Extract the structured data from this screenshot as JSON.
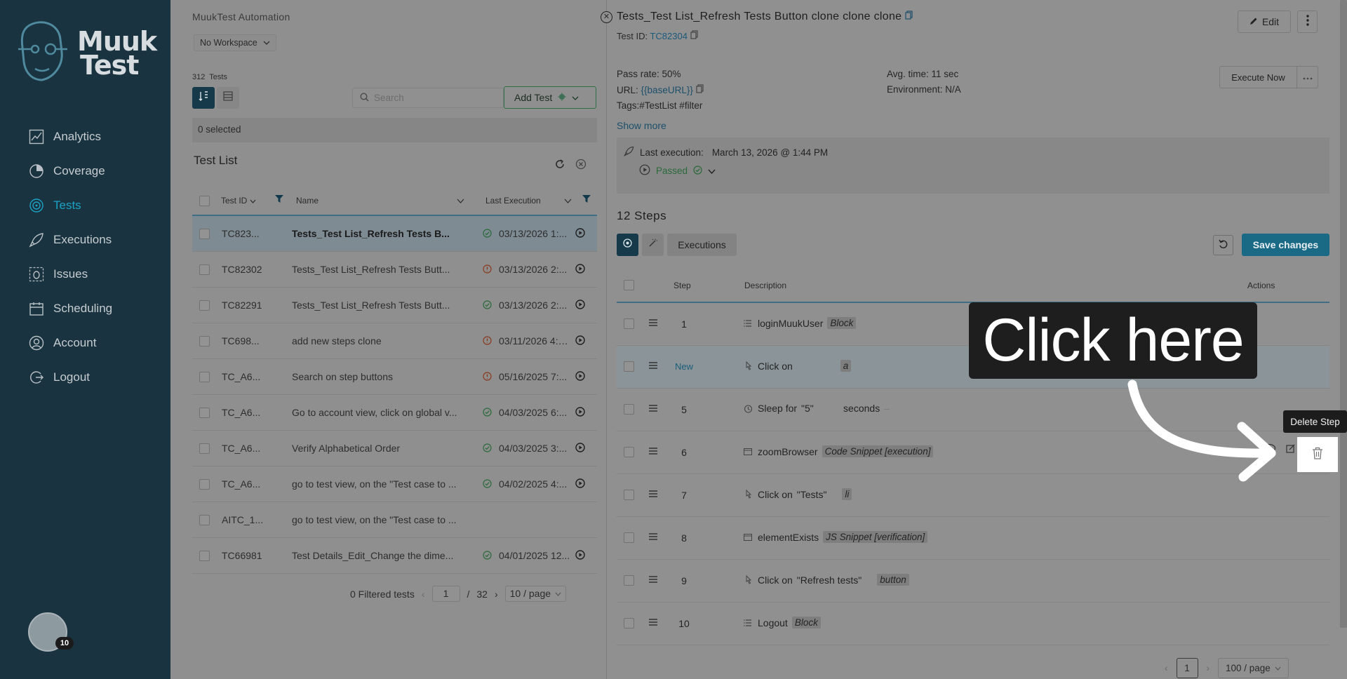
{
  "sidebar": {
    "logo_text": "MuukTest",
    "logo_line1": "Muuk",
    "logo_line2": "Test",
    "items": [
      {
        "label": "Analytics",
        "icon": "analytics-icon"
      },
      {
        "label": "Coverage",
        "icon": "coverage-icon"
      },
      {
        "label": "Tests",
        "icon": "tests-icon",
        "active": true
      },
      {
        "label": "Executions",
        "icon": "rocket-icon"
      },
      {
        "label": "Issues",
        "icon": "bug-icon"
      },
      {
        "label": "Scheduling",
        "icon": "calendar-icon"
      },
      {
        "label": "Account",
        "icon": "user-icon"
      },
      {
        "label": "Logout",
        "icon": "logout-icon"
      }
    ],
    "avatar_badge": "10"
  },
  "middle": {
    "workspace_title": "MuukTest Automation",
    "workspace_select": "No Workspace",
    "test_count_num": "312",
    "test_count_label": "Tests",
    "search_placeholder": "Search",
    "add_test": "Add Test",
    "selected": "0 selected",
    "list_title": "Test List",
    "columns": {
      "id": "Test ID",
      "name": "Name",
      "last_exec": "Last Execution"
    },
    "rows": [
      {
        "id": "TC823...",
        "name": "Tests_Test List_Refresh Tests B...",
        "status": "pass",
        "date": "03/13/2026 1:...",
        "selected": true
      },
      {
        "id": "TC82302",
        "name": "Tests_Test List_Refresh Tests Butt...",
        "status": "fail",
        "date": "03/13/2026 2:..."
      },
      {
        "id": "TC82291",
        "name": "Tests_Test List_Refresh Tests Butt...",
        "status": "pass",
        "date": "03/13/2026 2:..."
      },
      {
        "id": "TC698...",
        "name": "add new steps clone",
        "status": "fail",
        "date": "03/11/2026 4:1..."
      },
      {
        "id": "TC_A6...",
        "name": "Search on step buttons",
        "status": "fail",
        "date": "05/16/2025 7:..."
      },
      {
        "id": "TC_A6...",
        "name": "Go to account view, click on global v...",
        "status": "pass",
        "date": "04/03/2025 6:..."
      },
      {
        "id": "TC_A6...",
        "name": "Verify Alphabetical Order",
        "status": "pass",
        "date": "04/03/2025 3:..."
      },
      {
        "id": "TC_A6...",
        "name": "go to test view, on the \"Test case to ...",
        "status": "pass",
        "date": "04/02/2025 4:..."
      },
      {
        "id": "AITC_1...",
        "name": "go to test view, on the \"Test case to ...",
        "status": "",
        "date": ""
      },
      {
        "id": "TC66981",
        "name": "Test Details_Edit_Change the dime...",
        "status": "pass",
        "date": "04/01/2025 12..."
      }
    ],
    "pager": {
      "filtered": "0 Filtered tests",
      "page": "1",
      "sep": "/",
      "total": "32",
      "size": "10 / page"
    }
  },
  "detail": {
    "title": "Tests_Test List_Refresh Tests Button clone clone clone",
    "test_id_label": "Test ID:",
    "test_id": "TC82304",
    "edit": "Edit",
    "pass_rate": "Pass rate: 50%",
    "url_label": "URL:",
    "url": "{{baseURL}}",
    "tags_label": "Tags:",
    "tags": "#TestList #filter",
    "avg_time": "Avg. time: 11 sec",
    "environment": "Environment: N/A",
    "execute_now": "Execute Now",
    "show_more": "Show more",
    "last_exec_label": "Last execution:",
    "last_exec_date": "March 13, 2026 @ 1:44 PM",
    "last_exec_status": "Passed",
    "steps_title": "12 Steps",
    "executions_tab": "Executions",
    "save_changes": "Save changes",
    "step_columns": {
      "step": "Step",
      "description": "Description",
      "actions": "Actions"
    },
    "steps": [
      {
        "num": "1",
        "action": "loginMuukUser",
        "tag": "Block",
        "icon": "list-icon"
      },
      {
        "num": "New",
        "action": "Click on",
        "value": "",
        "tag": "a",
        "icon": "click-icon",
        "is_new": true
      },
      {
        "num": "5",
        "action": "Sleep for",
        "value": "\"5\"",
        "suffix": "seconds",
        "icon": "alarm-icon"
      },
      {
        "num": "6",
        "action": "zoomBrowser",
        "tag": "Code Snippet [execution]",
        "icon": "code-icon"
      },
      {
        "num": "7",
        "action": "Click on",
        "value": "\"Tests\"",
        "tag": "li",
        "icon": "click-icon"
      },
      {
        "num": "8",
        "action": "elementExists",
        "tag": "JS Snippet [verification]",
        "icon": "code-icon"
      },
      {
        "num": "9",
        "action": "Click on",
        "value": "\"Refresh tests\"",
        "tag": "button",
        "icon": "click-icon"
      },
      {
        "num": "10",
        "action": "Logout",
        "tag": "Block",
        "icon": "list-icon"
      }
    ],
    "steps_pager": {
      "page": "1",
      "size": "100 / page"
    }
  },
  "overlay": {
    "callout": "Click here",
    "tooltip": "Delete Step"
  }
}
